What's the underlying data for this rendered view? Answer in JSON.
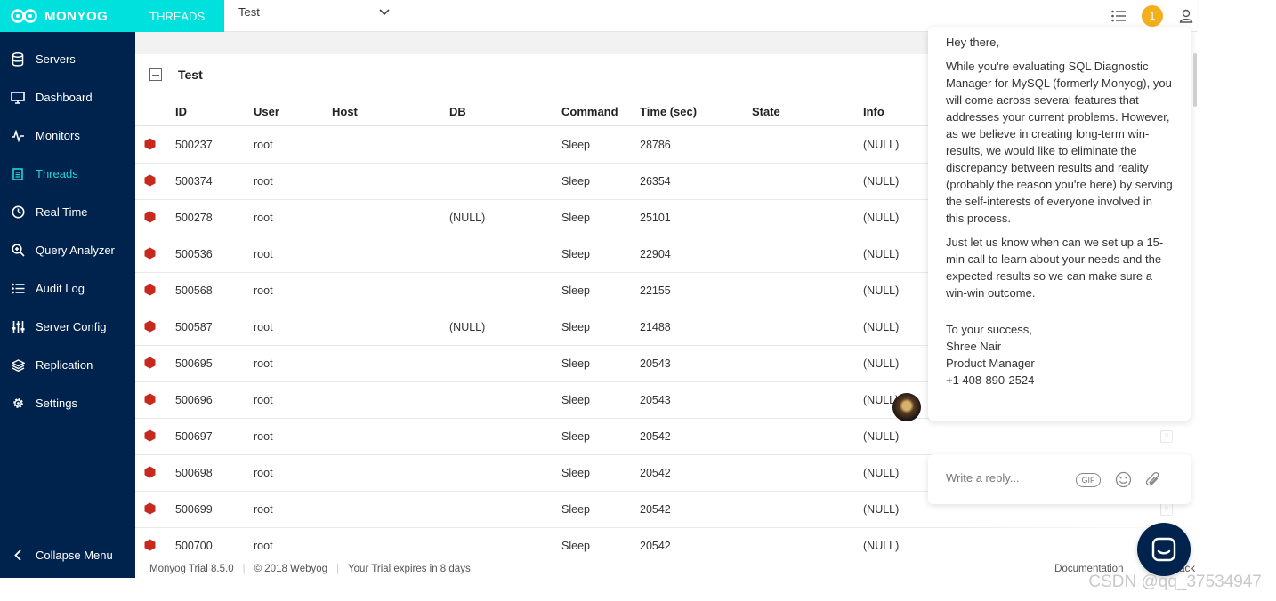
{
  "brand": {
    "name": "MONYOG"
  },
  "header": {
    "section_tab": "THREADS",
    "server_select": "Test",
    "notification_count": "1"
  },
  "sidebar": {
    "items": [
      {
        "label": "Servers",
        "icon": "database-icon"
      },
      {
        "label": "Dashboard",
        "icon": "monitor-icon"
      },
      {
        "label": "Monitors",
        "icon": "pulse-icon"
      },
      {
        "label": "Threads",
        "icon": "document-icon",
        "active": true
      },
      {
        "label": "Real Time",
        "icon": "clock-icon"
      },
      {
        "label": "Query Analyzer",
        "icon": "search-zoom-icon"
      },
      {
        "label": "Audit Log",
        "icon": "list-icon"
      },
      {
        "label": "Server Config",
        "icon": "sliders-icon"
      },
      {
        "label": "Replication",
        "icon": "layers-icon"
      },
      {
        "label": "Settings",
        "icon": "gear-icon"
      }
    ],
    "collapse_label": "Collapse Menu"
  },
  "panel": {
    "title": "Test",
    "columns": [
      "ID",
      "User",
      "Host",
      "DB",
      "Command",
      "Time (sec)",
      "State",
      "Info"
    ],
    "rows": [
      {
        "id": "500237",
        "user": "root",
        "host": "",
        "db": "",
        "command": "Sleep",
        "time": "28786",
        "state": "",
        "info": "(NULL)"
      },
      {
        "id": "500374",
        "user": "root",
        "host": "",
        "db": "",
        "command": "Sleep",
        "time": "26354",
        "state": "",
        "info": "(NULL)"
      },
      {
        "id": "500278",
        "user": "root",
        "host": "",
        "db": "(NULL)",
        "command": "Sleep",
        "time": "25101",
        "state": "",
        "info": "(NULL)"
      },
      {
        "id": "500536",
        "user": "root",
        "host": "",
        "db": "",
        "command": "Sleep",
        "time": "22904",
        "state": "",
        "info": "(NULL)"
      },
      {
        "id": "500568",
        "user": "root",
        "host": "",
        "db": "",
        "command": "Sleep",
        "time": "22155",
        "state": "",
        "info": "(NULL)"
      },
      {
        "id": "500587",
        "user": "root",
        "host": "",
        "db": "(NULL)",
        "command": "Sleep",
        "time": "21488",
        "state": "",
        "info": "(NULL)"
      },
      {
        "id": "500695",
        "user": "root",
        "host": "",
        "db": "",
        "command": "Sleep",
        "time": "20543",
        "state": "",
        "info": "(NULL)"
      },
      {
        "id": "500696",
        "user": "root",
        "host": "",
        "db": "",
        "command": "Sleep",
        "time": "20543",
        "state": "",
        "info": "(NULL)"
      },
      {
        "id": "500697",
        "user": "root",
        "host": "",
        "db": "",
        "command": "Sleep",
        "time": "20542",
        "state": "",
        "info": "(NULL)"
      },
      {
        "id": "500698",
        "user": "root",
        "host": "",
        "db": "",
        "command": "Sleep",
        "time": "20542",
        "state": "",
        "info": "(NULL)"
      },
      {
        "id": "500699",
        "user": "root",
        "host": "",
        "db": "",
        "command": "Sleep",
        "time": "20542",
        "state": "",
        "info": "(NULL)"
      },
      {
        "id": "500700",
        "user": "root",
        "host": "",
        "db": "",
        "command": "Sleep",
        "time": "20542",
        "state": "",
        "info": "(NULL)"
      }
    ]
  },
  "footer": {
    "version": "Monyog Trial 8.5.0",
    "copyright": "©  2018 Webyog",
    "trial": "Your Trial expires in 8 days",
    "documentation": "Documentation",
    "feedback": "Feedback"
  },
  "chat": {
    "greeting": "Hey there,",
    "paragraph1": "While you're evaluating SQL Diagnostic Manager for MySQL (formerly Monyog), you will come across several features that addresses your current problems. However, as we believe in creating long-term win-results, we would like to eliminate the discrepancy between results and reality (probably the reason you're here) by serving the self-interests of everyone involved in this process.",
    "paragraph2": "Just let us know when can we set up a 15-min call to learn about your needs and the expected results so we can make sure a win-win outcome.",
    "signoff": "To your success,",
    "name": "Shree Nair",
    "role": "Product Manager",
    "phone": "+1 408-890-2524",
    "reply_placeholder": "Write a reply...",
    "gif_label": "GIF"
  },
  "watermark": "CSDN @qq_37534947",
  "colors": {
    "accent": "#00e1de",
    "sidebar": "#00234e",
    "status": "#c62a1c",
    "badge": "#f2b01e"
  }
}
